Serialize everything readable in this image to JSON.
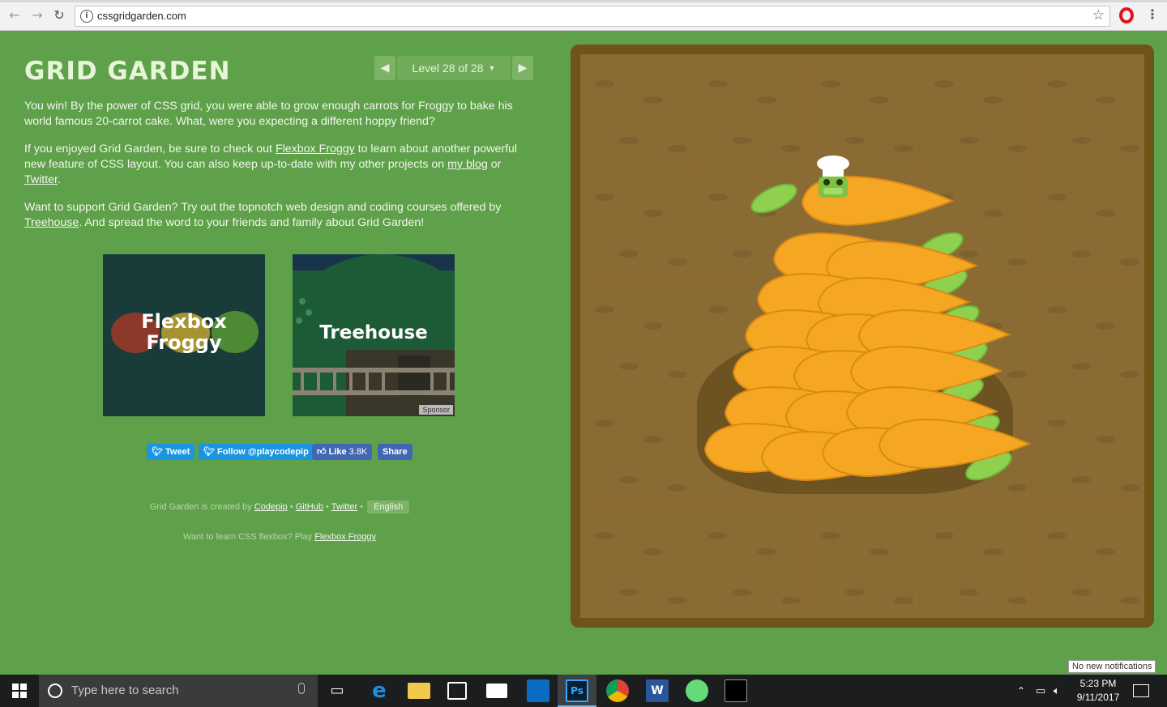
{
  "browser": {
    "url": "cssgridgarden.com",
    "back_icon": "arrow-left-icon",
    "forward_icon": "arrow-right-icon",
    "reload_icon": "reload-icon"
  },
  "game": {
    "title": "GRID GARDEN",
    "level_label": "Level 28 of 28",
    "prev_arrow": "◀",
    "next_arrow": "▶",
    "caret": "▼"
  },
  "content": {
    "p1": "You win! By the power of CSS grid, you were able to grow enough carrots for Froggy to bake his world famous 20-carrot cake. What, were you expecting a different hoppy friend?",
    "p2_before": "If you enjoyed Grid Garden, be sure to check out ",
    "p2_link1": "Flexbox Froggy",
    "p2_middle": " to learn about another powerful new feature of CSS layout. You can also keep up-to-date with my other projects on ",
    "p2_link2": "my blog",
    "p2_or": " or ",
    "p2_link3": "Twitter",
    "p2_end": ".",
    "p3_before": "Want to support Grid Garden? Try out the topnotch web design and coding courses offered by ",
    "p3_link": "Treehouse",
    "p3_after": ". And spread the word to your friends and family about Grid Garden!"
  },
  "promos": {
    "froggy_line1": "Flexbox",
    "froggy_line2": "Froggy",
    "treehouse": "Treehouse",
    "sponsor": "Sponsor"
  },
  "social": {
    "tweet": "Tweet",
    "follow": "Follow @playcodepip",
    "like": "Like",
    "like_count": "3.8K",
    "share": "Share"
  },
  "footer": {
    "created_by": "Grid Garden is created by ",
    "codepip": "Codepip",
    "github": "GitHub",
    "twitter": "Twitter",
    "sep": " • ",
    "language": "English",
    "learn_flexbox": "Want to learn CSS flexbox? Play ",
    "flexbox_link": "Flexbox Froggy"
  },
  "taskbar": {
    "search_placeholder": "Type here to search",
    "time": "5:23 PM",
    "date": "9/11/2017",
    "notification": "No new notifications"
  },
  "colors": {
    "background": "#5fa04a",
    "soil": "#8b6b34",
    "frame": "#6f5317",
    "carrot": "#f5a623",
    "leaf": "#8fd14f"
  }
}
